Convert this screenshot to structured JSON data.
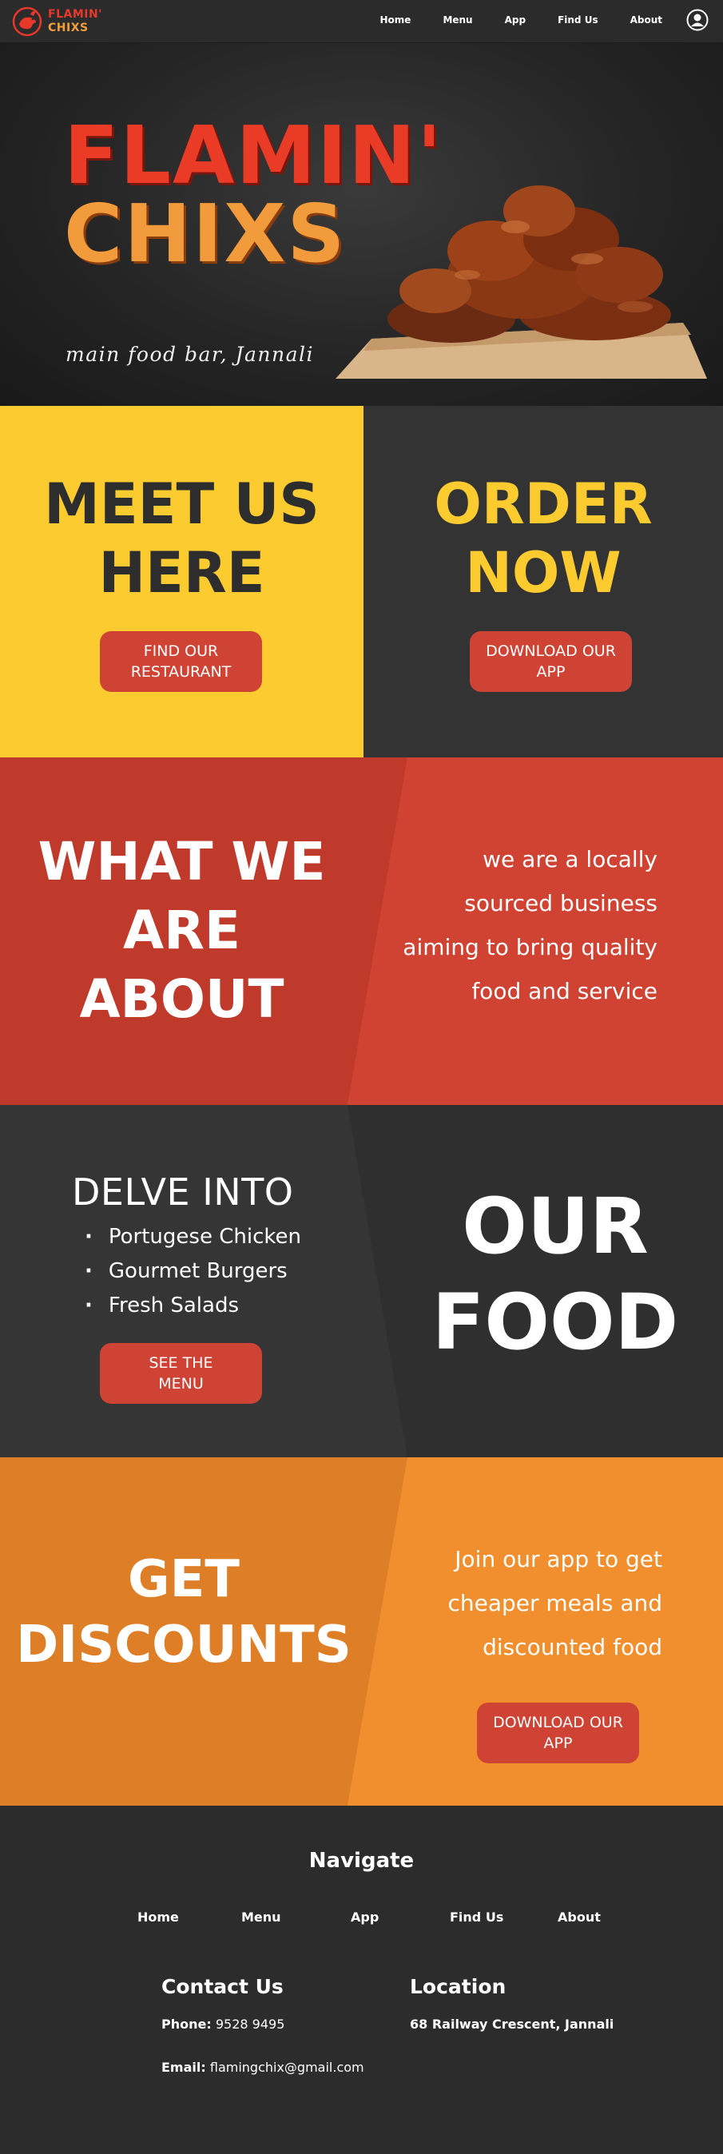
{
  "header": {
    "logo_line1": "FLAMIN'",
    "logo_line2": "CHIXS",
    "nav": [
      "Home",
      "Menu",
      "App",
      "Find Us",
      "About"
    ]
  },
  "hero": {
    "title_line1": "FLAMIN'",
    "title_line2": "CHIXS",
    "subtitle": "main food bar, Jannali"
  },
  "meet": {
    "title_line1": "MEET US",
    "title_line2": "HERE",
    "button_line1": "FIND OUR",
    "button_line2": "RESTAURANT"
  },
  "order": {
    "title_line1": "ORDER",
    "title_line2": "NOW",
    "button_line1": "DOWNLOAD OUR",
    "button_line2": "APP"
  },
  "about": {
    "title_line1": "WHAT WE",
    "title_line2": "ARE",
    "title_line3": "ABOUT",
    "text_lines": [
      "we are a locally",
      "sourced business",
      "aiming to bring quality",
      "food and service"
    ]
  },
  "food": {
    "heading": "DELVE INTO",
    "items": [
      "Portugese Chicken",
      "Gourmet Burgers",
      "Fresh Salads"
    ],
    "button_line1": "SEE THE",
    "button_line2": "MENU",
    "title_line1": "OUR",
    "title_line2": "FOOD"
  },
  "discounts": {
    "title_line1": "GET",
    "title_line2": "DISCOUNTS",
    "text_lines": [
      "Join our app to get",
      "cheaper meals and",
      "discounted food"
    ],
    "button_line1": "DOWNLOAD OUR",
    "button_line2": "APP"
  },
  "footer": {
    "nav_heading": "Navigate",
    "nav": [
      "Home",
      "Menu",
      "App",
      "Find Us",
      "About"
    ],
    "contact_heading": "Contact Us",
    "phone_label": "Phone:",
    "phone_value": "9528 9495",
    "email_label": "Email:",
    "email_value": "flamingchix@gmail.com",
    "location_heading": "Location",
    "address": "68 Railway Crescent, Jannali"
  },
  "colors": {
    "dark": "#2b2b2b",
    "yellow": "#fccb30",
    "red": "#d04232",
    "orange": "#f18f2f",
    "button": "#cf4334"
  }
}
